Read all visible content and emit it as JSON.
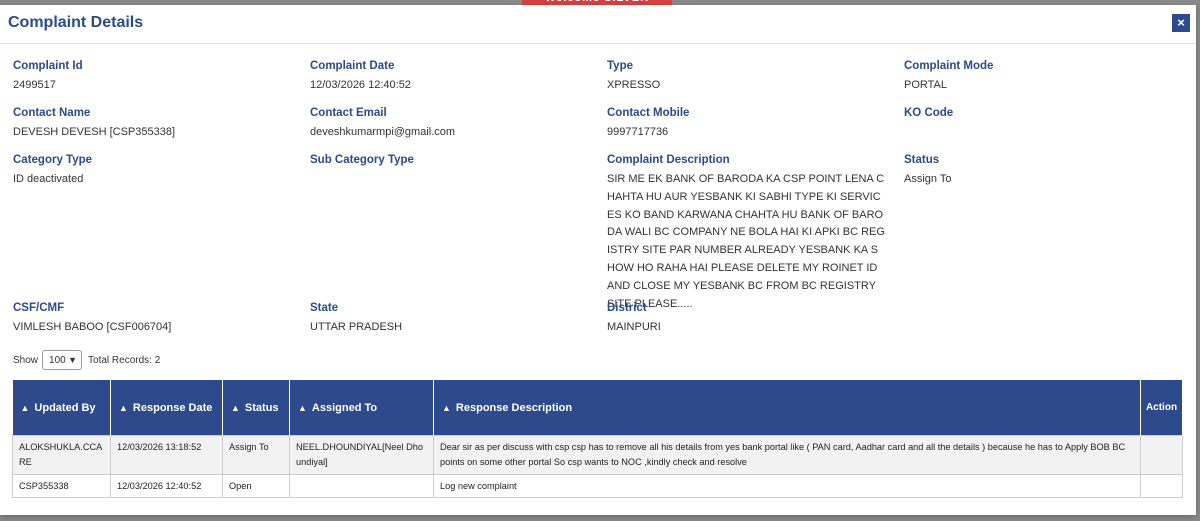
{
  "backdrop": {
    "banner_text": "Welcome SILVER PARTNER"
  },
  "modal": {
    "title": "Complaint Details",
    "close_icon": "×"
  },
  "details": {
    "complaint_id": {
      "label": "Complaint Id",
      "value": "2499517"
    },
    "complaint_date": {
      "label": "Complaint Date",
      "value": "12/03/2026 12:40:52"
    },
    "type": {
      "label": "Type",
      "value": "XPRESSO"
    },
    "complaint_mode": {
      "label": "Complaint Mode",
      "value": "PORTAL"
    },
    "contact_name": {
      "label": "Contact Name",
      "value": "DEVESH DEVESH [CSP355338]"
    },
    "contact_email": {
      "label": "Contact Email",
      "value": "deveshkumarmpi@gmail.com"
    },
    "contact_mobile": {
      "label": "Contact Mobile",
      "value": "9997717736"
    },
    "ko_code": {
      "label": "KO Code",
      "value": ""
    },
    "category_type": {
      "label": "Category Type",
      "value": "ID deactivated"
    },
    "sub_category_type": {
      "label": "Sub Category Type",
      "value": ""
    },
    "complaint_description": {
      "label": "Complaint Description",
      "value": "SIR ME EK BANK OF BARODA KA CSP POINT LENA CHAHTA HU AUR YESBANK KI SABHI TYPE KI SERVICES KO BAND KARWANA CHAHTA HU BANK OF BARODA WALI BC COMPANY NE BOLA HAI KI APKI BC REGISTRY SITE PAR NUMBER ALREADY YESBANK KA SHOW HO RAHA HAI PLEASE DELETE MY ROINET ID AND CLOSE MY YESBANK BC FROM BC REGISTRY SITE PLEASE....."
    },
    "status": {
      "label": "Status",
      "value": "Assign To"
    },
    "csf_cmf": {
      "label": "CSF/CMF",
      "value": "VIMLESH BABOO [CSF006704]"
    },
    "state": {
      "label": "State",
      "value": "UTTAR PRADESH"
    },
    "district": {
      "label": "District",
      "value": "MAINPURI"
    }
  },
  "pagination": {
    "show_label": "Show",
    "page_size": "100",
    "total_records": "Total Records: 2"
  },
  "table": {
    "sort_icon": "sort-icon",
    "columns": [
      "Updated By",
      "Response Date",
      "Status",
      "Assigned To",
      "Response Description",
      "Action"
    ],
    "rows": [
      {
        "updated_by": "ALOKSHUKLA.CCARE",
        "response_date": "12/03/2026 13:18:52",
        "status": "Assign To",
        "assigned_to": "NEEL.DHOUNDIYAL[Neel Dhoundiyal]",
        "response_description": "Dear sir as per discuss with csp csp has to remove all his details from yes bank portal like ( PAN card, Aadhar card and all the details ) because he has to Apply BOB BC points on some other portal So csp wants to NOC ,kindly check and resolve",
        "action": ""
      },
      {
        "updated_by": "CSP355338",
        "response_date": "12/03/2026 12:40:52",
        "status": "Open",
        "assigned_to": "",
        "response_description": "Log new complaint",
        "action": ""
      }
    ]
  }
}
